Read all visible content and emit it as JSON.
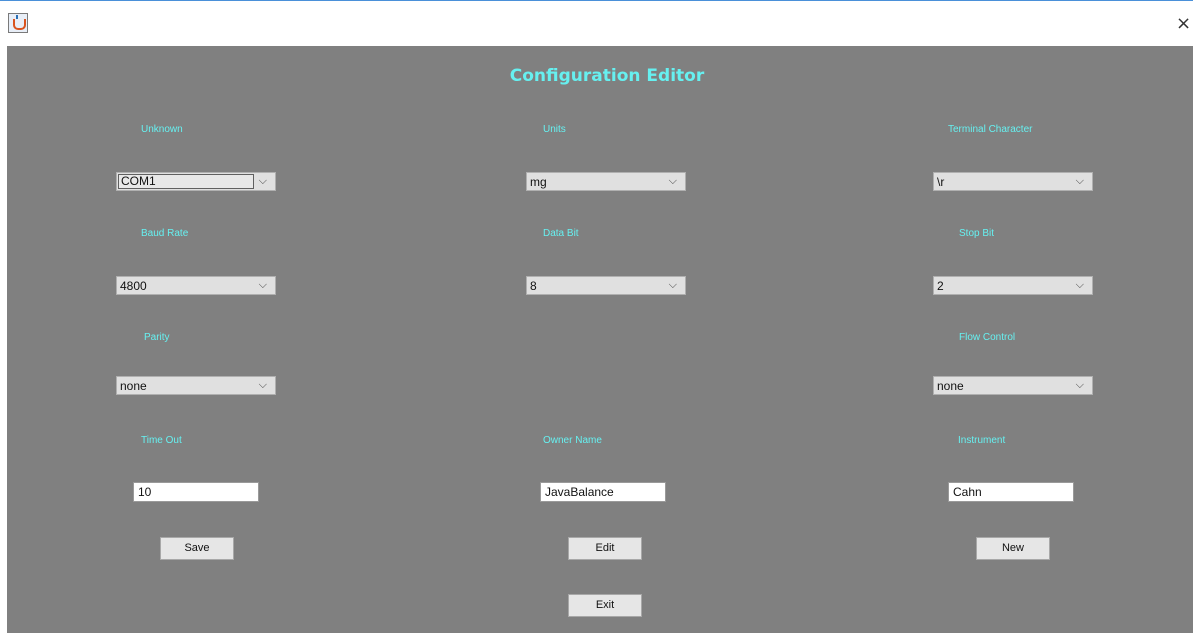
{
  "window": {
    "close_glyph": "×"
  },
  "editor": {
    "title": "Configuration Editor",
    "fields": {
      "unknown": {
        "label": "Unknown",
        "value": "COM1"
      },
      "units": {
        "label": "Units",
        "value": "mg"
      },
      "terminal": {
        "label": "Terminal Character",
        "value": "\\r"
      },
      "baud": {
        "label": "Baud Rate",
        "value": "4800"
      },
      "databit": {
        "label": "Data Bit",
        "value": "8"
      },
      "stopbit": {
        "label": "Stop Bit",
        "value": "2"
      },
      "parity": {
        "label": "Parity",
        "value": "none"
      },
      "flow": {
        "label": "Flow Control",
        "value": "none"
      },
      "timeout": {
        "label": "Time Out",
        "value": "10"
      },
      "owner": {
        "label": "Owner Name",
        "value": "JavaBalance"
      },
      "instrument": {
        "label": "Instrument",
        "value": "Cahn"
      }
    },
    "buttons": {
      "save": "Save",
      "edit": "Edit",
      "new": "New",
      "exit": "Exit"
    },
    "combo_arrow": "⌵"
  },
  "colors": {
    "background": "#808080",
    "label": "#66f0f0",
    "combo": "#e0e0e0",
    "button": "#e6e6e6"
  },
  "icons": {
    "app": "java-coffee-cup-icon",
    "close": "close-icon"
  }
}
